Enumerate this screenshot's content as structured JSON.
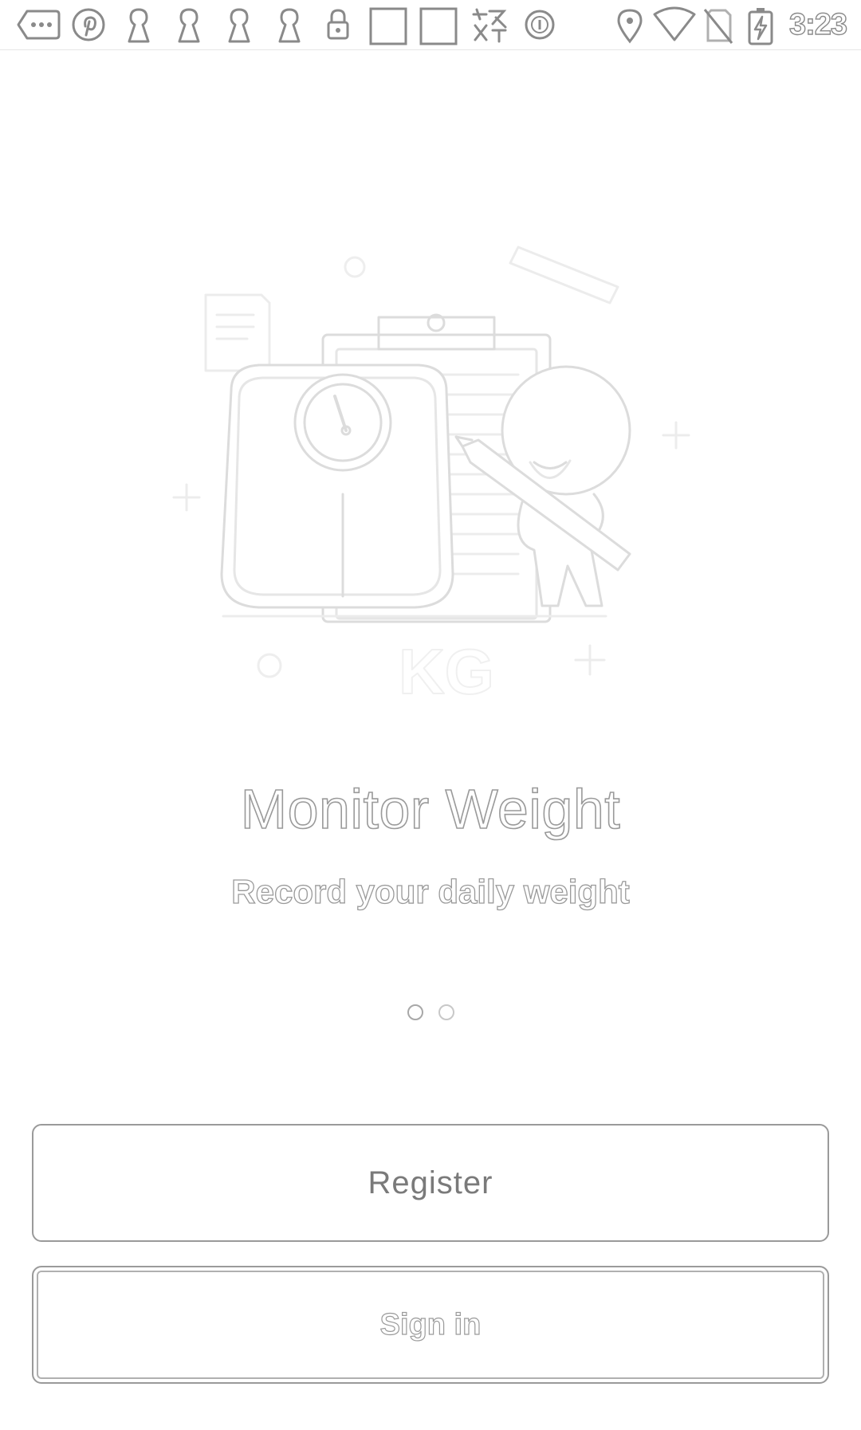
{
  "status_bar": {
    "time": "3:23",
    "icons": [
      "more-chat-icon",
      "pinterest-icon",
      "keyhole-icon",
      "keyhole-icon",
      "keyhole-icon",
      "keyhole-icon",
      "lock-icon",
      "blank-square-icon",
      "blank-square-icon",
      "app-glyph-icon",
      "circle-i-icon",
      "location-icon",
      "wifi-icon",
      "no-sim-icon",
      "battery-charging-icon"
    ]
  },
  "onboarding": {
    "title": "Monitor Weight",
    "subtitle": "Record your daily weight",
    "illustration_label": "KG",
    "pages_total": 2,
    "active_page": 1
  },
  "actions": {
    "register_label": "Register",
    "signin_label": "Sign in"
  },
  "colors": {
    "outline": "#9a9a9a",
    "background": "#ffffff"
  }
}
